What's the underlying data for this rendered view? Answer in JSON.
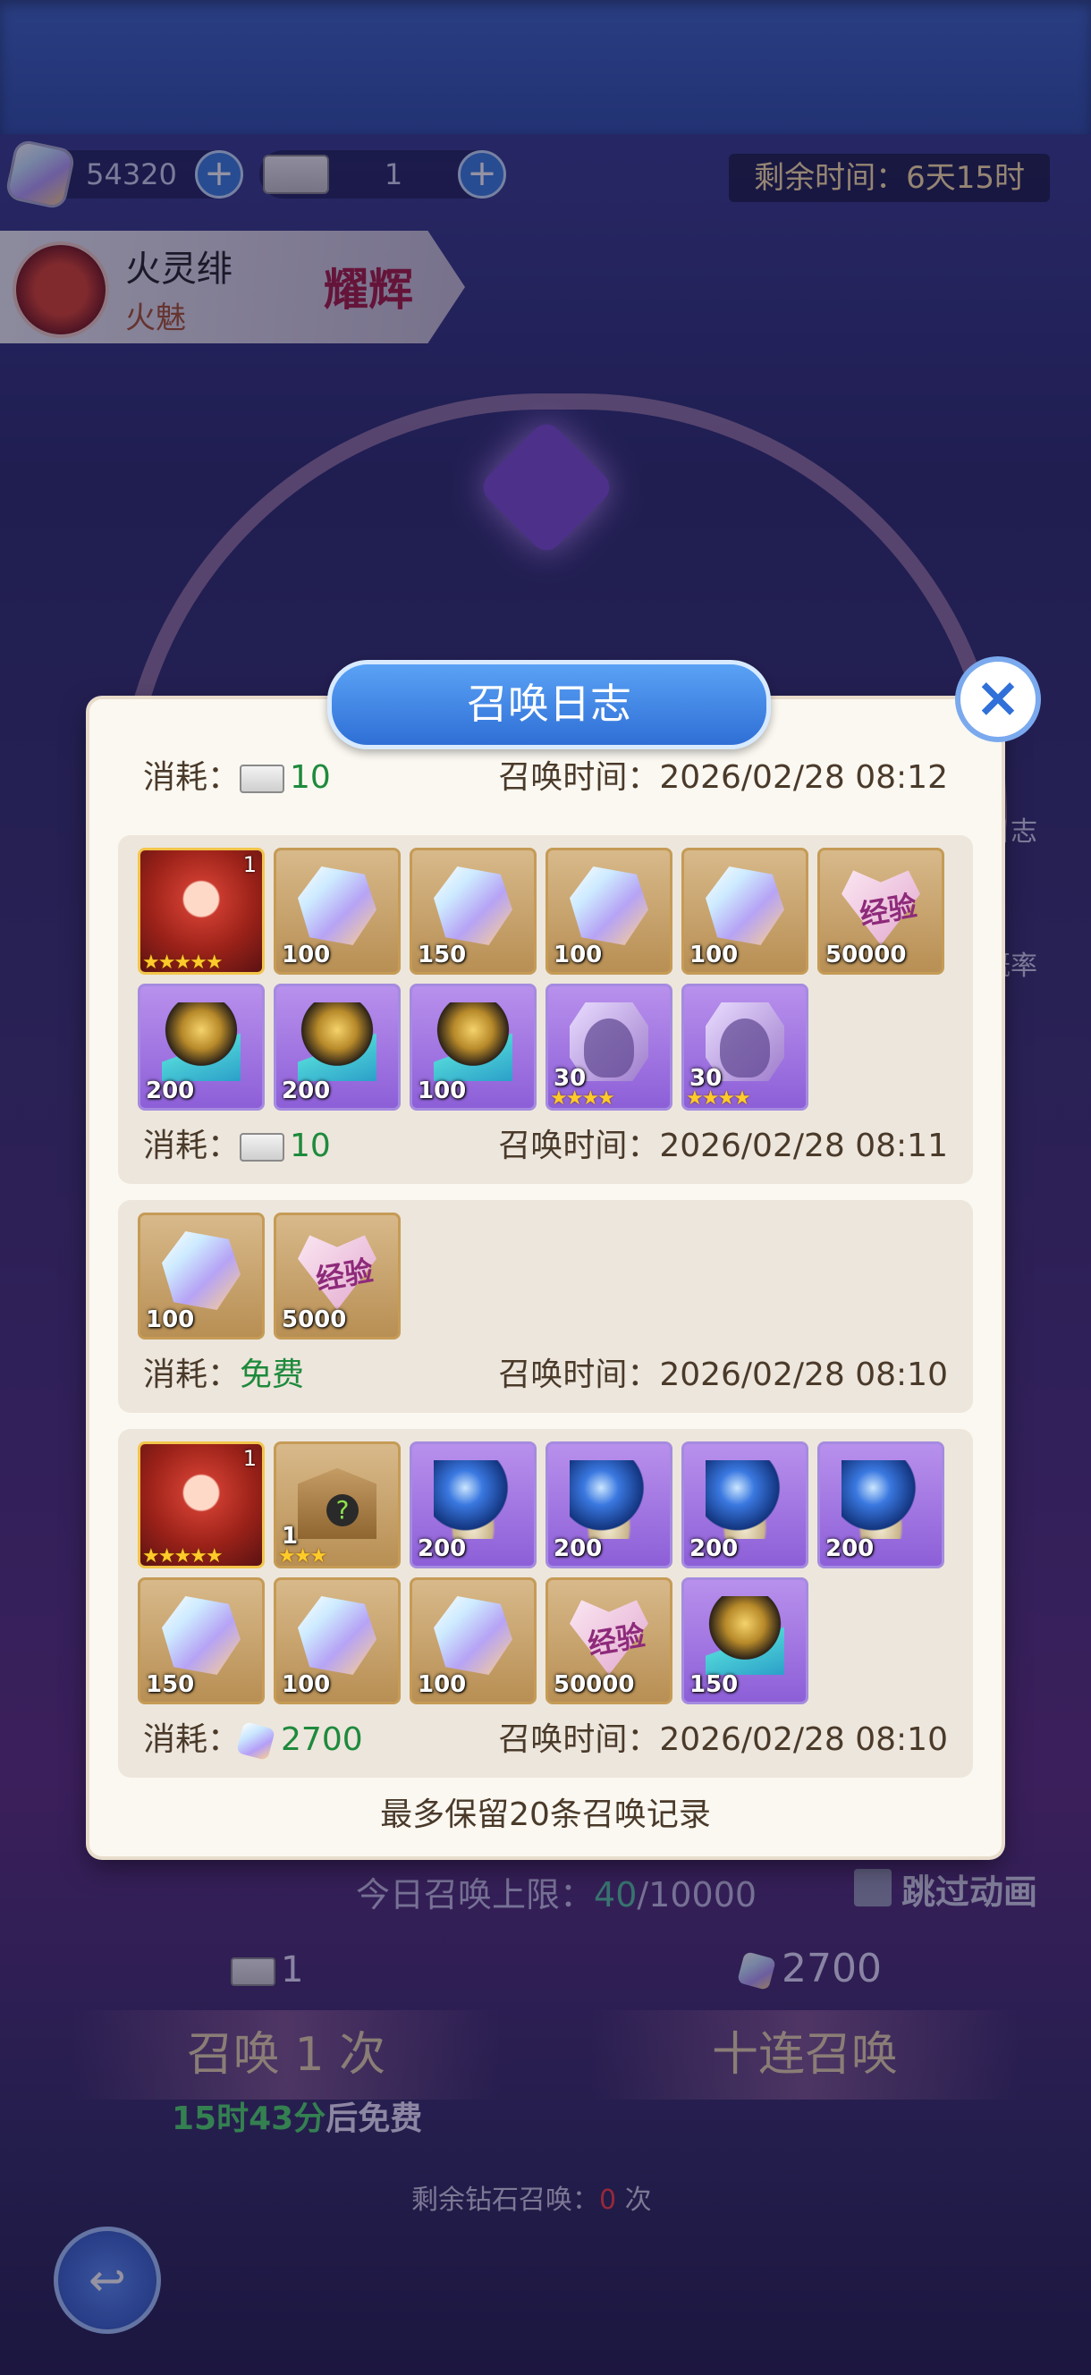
{
  "header": {
    "diamonds": "54320",
    "tickets": "1",
    "countdown_label": "剩余时间：",
    "countdown_value": "6天15时"
  },
  "hero": {
    "name": "火灵绯",
    "subtitle": "火魅",
    "badge": "耀辉"
  },
  "side_buttons": {
    "log": "日志",
    "rate": "概率"
  },
  "modal": {
    "title": "召唤日志",
    "cost_label": "消耗：",
    "time_label": "召唤时间：",
    "footer": "最多保留20条召唤记录"
  },
  "records": [
    {
      "cost_type": "ticket",
      "cost": "10",
      "time": "2026/02/28 08:12",
      "items": []
    },
    {
      "cost_type": "ticket",
      "cost": "10",
      "time": "2026/02/28 08:11",
      "items": [
        {
          "kind": "hero",
          "count": "1",
          "stars": "★★★★★"
        },
        {
          "kind": "crystal",
          "qty": "100"
        },
        {
          "kind": "crystal",
          "qty": "150"
        },
        {
          "kind": "crystal",
          "qty": "100"
        },
        {
          "kind": "crystal",
          "qty": "100"
        },
        {
          "kind": "exp",
          "qty": "50000",
          "label": "经验"
        },
        {
          "kind": "egg",
          "qty": "200"
        },
        {
          "kind": "egg",
          "qty": "200"
        },
        {
          "kind": "egg",
          "qty": "100"
        },
        {
          "kind": "shard",
          "qty": "30",
          "stars": "★★★★"
        },
        {
          "kind": "shard",
          "qty": "30",
          "stars": "★★★★"
        }
      ]
    },
    {
      "cost_type": "free",
      "cost": "免费",
      "time": "2026/02/28 08:10",
      "items": [
        {
          "kind": "crystal",
          "qty": "100"
        },
        {
          "kind": "exp",
          "qty": "5000",
          "label": "经验"
        }
      ]
    },
    {
      "cost_type": "diamond",
      "cost": "2700",
      "time": "2026/02/28 08:10",
      "items": [
        {
          "kind": "hero",
          "count": "1",
          "stars": "★★★★★"
        },
        {
          "kind": "box",
          "qty": "1",
          "stars": "★★★"
        },
        {
          "kind": "orb",
          "qty": "200"
        },
        {
          "kind": "orb",
          "qty": "200"
        },
        {
          "kind": "orb",
          "qty": "200"
        },
        {
          "kind": "orb",
          "qty": "200"
        },
        {
          "kind": "crystal",
          "qty": "150"
        },
        {
          "kind": "crystal",
          "qty": "100"
        },
        {
          "kind": "crystal",
          "qty": "100"
        },
        {
          "kind": "exp",
          "qty": "50000",
          "label": "经验"
        },
        {
          "kind": "egg",
          "qty": "150"
        }
      ]
    }
  ],
  "bottom": {
    "limit_label": "今日召唤上限：",
    "limit_used": "40",
    "limit_total": "/10000",
    "skip_label": "跳过动画",
    "single_cost": "1",
    "ten_cost": "2700",
    "single_button": "召唤 1 次",
    "ten_button": "十连召唤",
    "free_time": "15时43分",
    "free_suffix": "后免费",
    "remain_label": "剩余钻石召唤：",
    "remain_value": "0",
    "remain_unit": "次"
  },
  "colors": {
    "cost_green": "#1e8a3c",
    "title_blue": "#2f6fd6",
    "free_green": "#4fdc6a",
    "remain_red": "#ff3f3f"
  }
}
